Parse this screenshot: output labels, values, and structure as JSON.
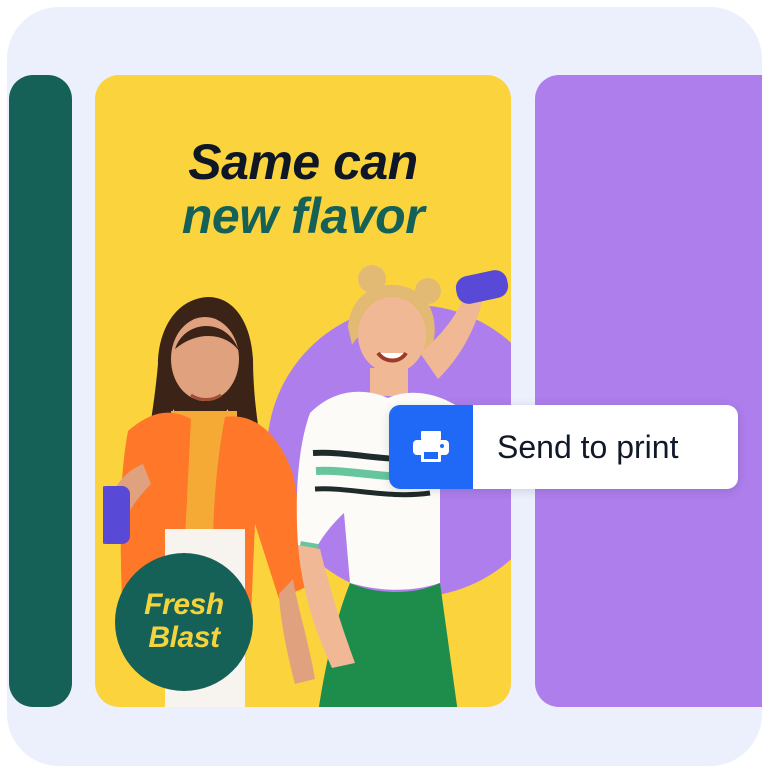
{
  "poster": {
    "headline_line_1": "Same can",
    "headline_line_2": "new flavor",
    "badge_line_1": "Fresh",
    "badge_line_2": "Blast"
  },
  "action": {
    "send_to_print_label": "Send to print",
    "icon": "printer-icon"
  },
  "colors": {
    "frame_background": "#EBF0FC",
    "left_panel": "#156158",
    "poster_background": "#FBD43D",
    "right_panel": "#AD7EEC",
    "headline_dark": "#0F1727",
    "headline_green": "#156158",
    "badge_text": "#F4D33D",
    "print_button_blue": "#1F69F6"
  }
}
